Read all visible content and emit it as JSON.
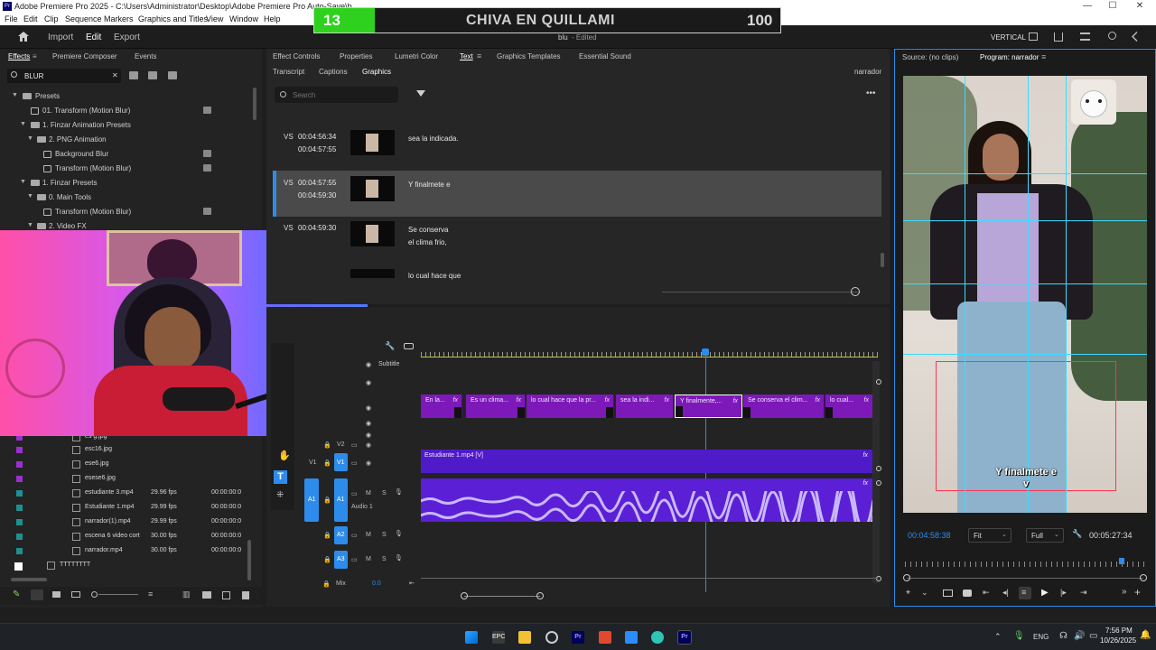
{
  "window": {
    "title": "Adobe Premiere Pro 2025 - C:\\Users\\Administrator\\Desktop\\Adobe Premiere Pro Auto-Save\\b",
    "app_logo": "Pr"
  },
  "menu": [
    "File",
    "Edit",
    "Clip",
    "Sequence",
    "Markers",
    "Graphics and Titles",
    "View",
    "Window",
    "Help"
  ],
  "appbar": {
    "home_icon": "home-icon",
    "nav": [
      "Import",
      "Edit",
      "Export"
    ],
    "active_nav": "Edit",
    "project_name": "blu",
    "project_status": "- Edited",
    "workspace": "VERTICAL"
  },
  "scoreboard": {
    "number": "13",
    "title": "CHIVA EN QUILLAMI",
    "score": "100",
    "progress_fraction": 0.13
  },
  "effects_panel": {
    "tabs": [
      "Effects",
      "Premiere Composer",
      "Events"
    ],
    "search_value": "BLUR",
    "tree": [
      {
        "label": "Presets",
        "depth": 0,
        "type": "folder"
      },
      {
        "label": "01. Transform (Motion Blur)",
        "depth": 1,
        "type": "fx"
      },
      {
        "label": "1. Finzar Animation Presets",
        "depth": 1,
        "type": "folder"
      },
      {
        "label": "2. PNG Animation",
        "depth": 2,
        "type": "folder"
      },
      {
        "label": "Background Blur",
        "depth": 3,
        "type": "fx"
      },
      {
        "label": "Transform (Motion Blur)",
        "depth": 3,
        "type": "fx"
      },
      {
        "label": "1. Finzar Presets",
        "depth": 1,
        "type": "folder"
      },
      {
        "label": "0. Main Tools",
        "depth": 2,
        "type": "folder"
      },
      {
        "label": "Transform (Motion Blur)",
        "depth": 3,
        "type": "fx"
      },
      {
        "label": "2. Video FX",
        "depth": 2,
        "type": "folder"
      }
    ]
  },
  "project_items": [
    {
      "name": "es g.jpg",
      "fps": "",
      "tc": "",
      "color": "#9b2fd0"
    },
    {
      "name": "esc16.jpg",
      "fps": "",
      "tc": "",
      "color": "#9b2fd0"
    },
    {
      "name": "ese6.jpg",
      "fps": "",
      "tc": "",
      "color": "#9b2fd0"
    },
    {
      "name": "esese6.jpg",
      "fps": "",
      "tc": "",
      "color": "#9b2fd0"
    },
    {
      "name": "estudiante 3.mp4",
      "fps": "29.96 fps",
      "tc": "00:00:00:0",
      "color": "#1f8f8f"
    },
    {
      "name": "Estudiante 1.mp4",
      "fps": "29.99 fps",
      "tc": "00:00:00:0",
      "color": "#1f8f8f"
    },
    {
      "name": "narrador(1).mp4",
      "fps": "29.99 fps",
      "tc": "00:00:00:0",
      "color": "#1f8f8f"
    },
    {
      "name": "escena 6 video cort",
      "fps": "30.00 fps",
      "tc": "00:00:00:0",
      "color": "#1f8f8f"
    },
    {
      "name": "narrador.mp4",
      "fps": "30.00 fps",
      "tc": "00:00:00:0",
      "color": "#1f8f8f"
    },
    {
      "name": "TTTTTTTT",
      "fps": "",
      "tc": "",
      "color": "#ffffff"
    }
  ],
  "text_panel": {
    "top_tabs": [
      "Effect Controls",
      "Properties",
      "Lumetri Color",
      "Text",
      "Graphics Templates",
      "Essential Sound"
    ],
    "active_top_tab": "Text",
    "sub_tabs": [
      "Transcript",
      "Captions",
      "Graphics"
    ],
    "active_sub_tab": "Graphics",
    "sequence_name": "narrador",
    "search_placeholder": "Search",
    "captions": [
      {
        "track": "VS",
        "start": "00:04:56:34",
        "end": "00:04:57:55",
        "text": "sea la indicada.",
        "selected": false
      },
      {
        "track": "VS",
        "start": "00:04:57:55",
        "end": "00:04:59:30",
        "text": "Y finalmete e",
        "selected": true
      },
      {
        "track": "VS",
        "start": "00:04:59:30",
        "end": "",
        "text": "Se conserva\nel clima frio,",
        "selected": false
      },
      {
        "track": "",
        "start": "",
        "end": "",
        "text": "lo cual hace que",
        "selected": false
      }
    ]
  },
  "timeline": {
    "subtitle_track_label": "Subtitle",
    "caption_clips": [
      {
        "label": "En la...",
        "fx": "fx"
      },
      {
        "label": "Es un clima...",
        "fx": "fx"
      },
      {
        "label": "lo cual hace que la pr...",
        "fx": "fx"
      },
      {
        "label": "sea la indi...",
        "fx": "fx"
      },
      {
        "label": "Y finalmente,...",
        "fx": "fx"
      },
      {
        "label": "Se conserva el clim...",
        "fx": "fx"
      },
      {
        "label": "lo cual...",
        "fx": "fx"
      }
    ],
    "video_clip": {
      "label": "Estudiante 1.mp4 [V]",
      "fx": "fx"
    },
    "tracks": {
      "v2": "V2",
      "v1": "V1",
      "v1_source": "V1",
      "a1": "A1",
      "a1_source": "A1",
      "a1_name": "Audio 1",
      "a2": "A2",
      "a3": "A3",
      "m": "M",
      "s": "S",
      "mix_label": "Mix",
      "mix_value": "0.0"
    }
  },
  "monitor": {
    "source_tab": "Source: (no clips)",
    "program_tab": "Program: narrador",
    "caption_overlay": "Y finalmete e\nv",
    "timecode_current": "00:04:58:38",
    "fit": "Fit",
    "resolution": "Full",
    "timecode_duration": "00:05:27:34"
  },
  "taskbar": {
    "lang": "ENG",
    "time": "7:56 PM",
    "date": "10/26/2025"
  },
  "colors": {
    "accent_blue": "#2d8ceb",
    "caption_clip": "#7d19b8",
    "video_clip": "#4f1bc9",
    "audio_clip": "#5b1fd6",
    "score_green": "#2fd11f",
    "guide": "#3fd9ff"
  }
}
